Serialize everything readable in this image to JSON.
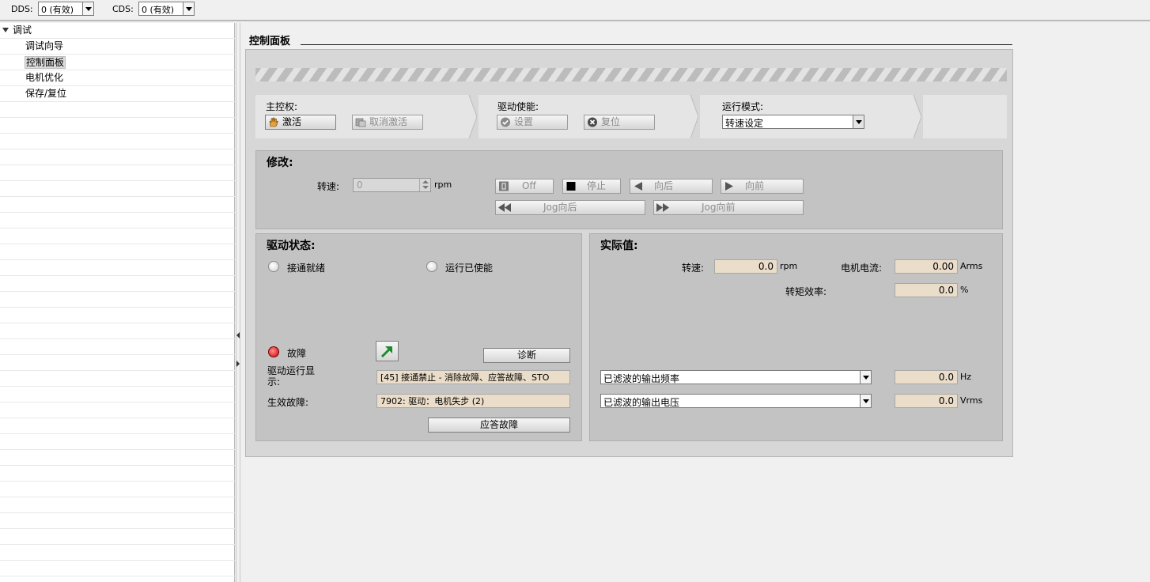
{
  "toolbar": {
    "dds_label": "DDS:",
    "dds_value": "0 (有效)",
    "cds_label": "CDS:",
    "cds_value": "0 (有效)"
  },
  "tree": {
    "root": "调试",
    "items": [
      "调试向导",
      "控制面板",
      "电机优化",
      "保存/复位"
    ],
    "selected": "控制面板"
  },
  "page": {
    "title": "控制面板"
  },
  "master_control": {
    "label": "主控权:",
    "activate": "激活",
    "deactivate": "取消激活"
  },
  "drive_enable": {
    "label": "驱动使能:",
    "set": "设置",
    "reset": "复位"
  },
  "operating_mode": {
    "label": "运行模式:",
    "value": "转速设定"
  },
  "modify": {
    "title": "修改:",
    "speed_label": "转速:",
    "speed_value": "0",
    "speed_unit": "rpm",
    "off": "Off",
    "stop": "停止",
    "backward": "向后",
    "forward": "向前",
    "jog_backward": "Jog向后",
    "jog_forward": "Jog向前"
  },
  "drive_status": {
    "title": "驱动状态:",
    "ready_on": "接通就绪",
    "operation_enabled": "运行已使能",
    "fault": "故障",
    "diagnose": "诊断",
    "operation_display_label": "驱动运行显示:",
    "operation_display_value": "[45] 接通禁止 - 消除故障、应答故障、STO",
    "active_fault_label": "生效故障:",
    "active_fault_value": "7902: 驱动：电机失步 (2)",
    "acknowledge": "应答故障"
  },
  "actual_values": {
    "title": "实际值:",
    "speed_label": "转速:",
    "speed_value": "0.0",
    "speed_unit": "rpm",
    "current_label": "电机电流:",
    "current_value": "0.00",
    "current_unit": "Arms",
    "torque_label": "转矩效率:",
    "torque_value": "0.0",
    "torque_unit": "%",
    "select1": "已滤波的输出频率",
    "value1": "0.0",
    "unit1": "Hz",
    "select2": "已滤波的输出电压",
    "value2": "0.0",
    "unit2": "Vrms"
  },
  "colors": {
    "value_bg": "#eaddc9",
    "group_bg": "#c3c3c3",
    "fault_led": "#d00000",
    "jump_arrow": "#1b8a2e"
  }
}
